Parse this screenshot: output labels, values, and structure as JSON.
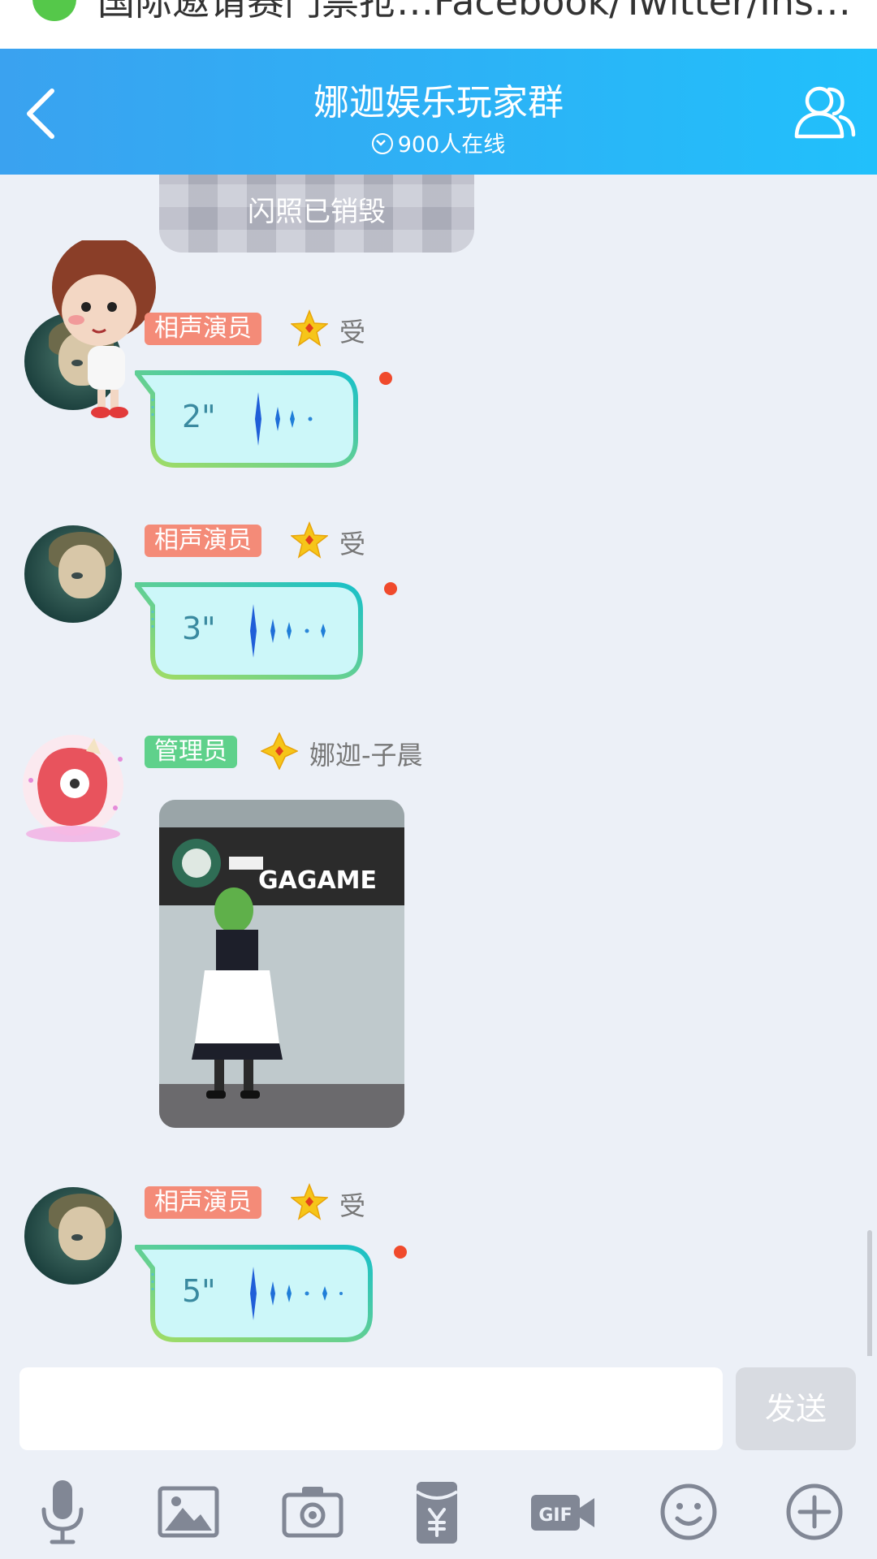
{
  "top_notification": {
    "text": "国际邀请赛门票抢…Facebook/Twitter/Ins…"
  },
  "header": {
    "title": "娜迦娱乐玩家群",
    "online": "900人在线"
  },
  "colors": {
    "header_start": "#3aa2f0",
    "header_end": "#21c0fb",
    "badge_red": "#f48b78",
    "badge_green": "#5fd18b",
    "unread_dot": "#f04a2c",
    "chat_bg": "#ecf0f7"
  },
  "messages": {
    "flash_photo": {
      "label": "闪照已销毁"
    },
    "voice1": {
      "badge": "相声演员",
      "name": "受",
      "duration": "2\""
    },
    "voice2": {
      "badge": "相声演员",
      "name": "受",
      "duration": "3\""
    },
    "admin_photo": {
      "badge": "管理员",
      "name": "娜迦-子晨",
      "photo_text": "GAGAME"
    },
    "voice3": {
      "badge": "相声演员",
      "name": "受",
      "duration": "5\""
    }
  },
  "input": {
    "placeholder": "",
    "value": "",
    "send_label": "发送"
  },
  "toolbar": {
    "icons": [
      "microphone-icon",
      "image-icon",
      "camera-icon",
      "red-packet-icon",
      "gif-icon",
      "emoji-icon",
      "plus-icon"
    ]
  }
}
